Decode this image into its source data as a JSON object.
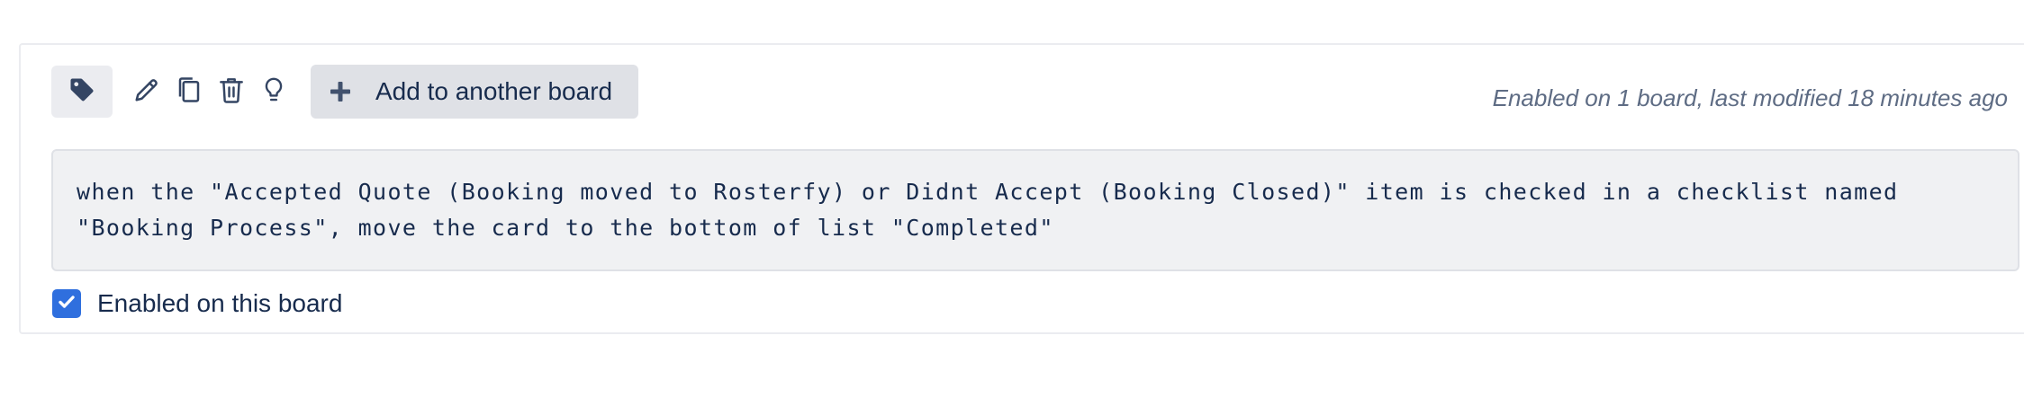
{
  "rule": {
    "toolbar": {
      "icons": {
        "tag": "tag-icon",
        "edit": "pencil-icon",
        "copy": "copy-icon",
        "delete": "trash-icon",
        "tip": "lightbulb-icon",
        "add": "plus-icon"
      },
      "add_board_label": "Add to another board"
    },
    "meta": "Enabled on 1 board, last modified 18 minutes ago",
    "rule_text": "when the \"Accepted Quote (Booking moved to Rosterfy) or Didnt Accept (Booking Closed)\" item is checked in a checklist named \"Booking Process\", move the card to the bottom of list \"Completed\"",
    "enabled_label": "Enabled on this board",
    "enabled_checked": true
  },
  "colors": {
    "accent": "#2f6fde",
    "text": "#172b4d",
    "muted": "#5e6c84",
    "button_bg": "#dfe1e6",
    "rule_bg": "#f0f1f3"
  }
}
